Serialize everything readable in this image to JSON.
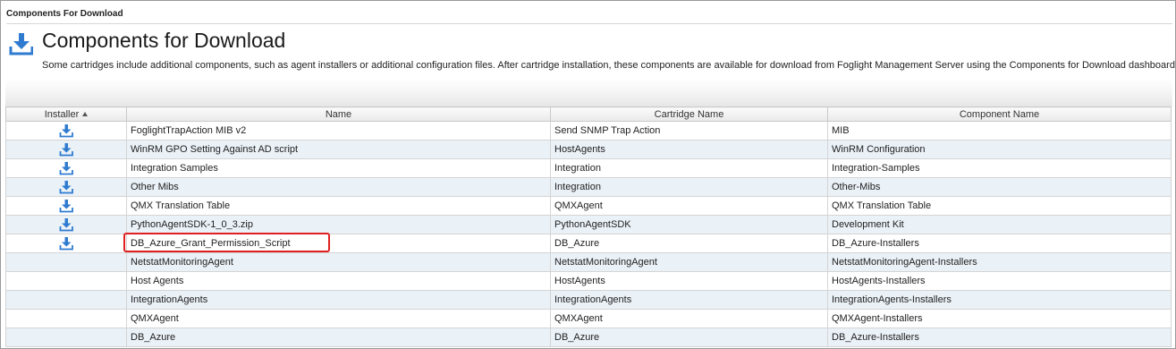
{
  "breadcrumb": "Components For Download",
  "page": {
    "title": "Components for Download",
    "description": "Some cartridges include additional components, such as agent installers or additional configuration files. After cartridge installation, these components are available for download from Foglight Management Server using the Components for Download dashboard."
  },
  "table": {
    "headers": {
      "installer": "Installer",
      "name": "Name",
      "cartridge": "Cartridge Name",
      "component": "Component Name"
    },
    "sort": "installer ascending",
    "rows": [
      {
        "installer": true,
        "name": "FoglightTrapAction MIB v2",
        "cartridge": "Send SNMP Trap Action",
        "component": "MIB"
      },
      {
        "installer": true,
        "name": "WinRM GPO Setting Against AD script",
        "cartridge": "HostAgents",
        "component": "WinRM Configuration"
      },
      {
        "installer": true,
        "name": "Integration Samples",
        "cartridge": "Integration",
        "component": "Integration-Samples"
      },
      {
        "installer": true,
        "name": "Other Mibs",
        "cartridge": "Integration",
        "component": "Other-Mibs"
      },
      {
        "installer": true,
        "name": "QMX Translation Table",
        "cartridge": "QMXAgent",
        "component": "QMX Translation Table"
      },
      {
        "installer": true,
        "name": "PythonAgentSDK-1_0_3.zip",
        "cartridge": "PythonAgentSDK",
        "component": "Development Kit"
      },
      {
        "installer": true,
        "name": "DB_Azure_Grant_Permission_Script",
        "cartridge": "DB_Azure",
        "component": "DB_Azure-Installers",
        "highlighted": true
      },
      {
        "installer": false,
        "name": "NetstatMonitoringAgent",
        "cartridge": "NetstatMonitoringAgent",
        "component": "NetstatMonitoringAgent-Installers"
      },
      {
        "installer": false,
        "name": "Host Agents",
        "cartridge": "HostAgents",
        "component": "HostAgents-Installers"
      },
      {
        "installer": false,
        "name": "IntegrationAgents",
        "cartridge": "IntegrationAgents",
        "component": "IntegrationAgents-Installers"
      },
      {
        "installer": false,
        "name": "QMXAgent",
        "cartridge": "QMXAgent",
        "component": "QMXAgent-Installers"
      },
      {
        "installer": false,
        "name": "DB_Azure",
        "cartridge": "DB_Azure",
        "component": "DB_Azure-Installers"
      }
    ]
  },
  "icons": {
    "title": "download-icon",
    "row": "download-icon"
  },
  "colors": {
    "icon_blue": "#2f7bd0",
    "highlight": "#e02020",
    "row_alt": "#eaf1f7"
  }
}
